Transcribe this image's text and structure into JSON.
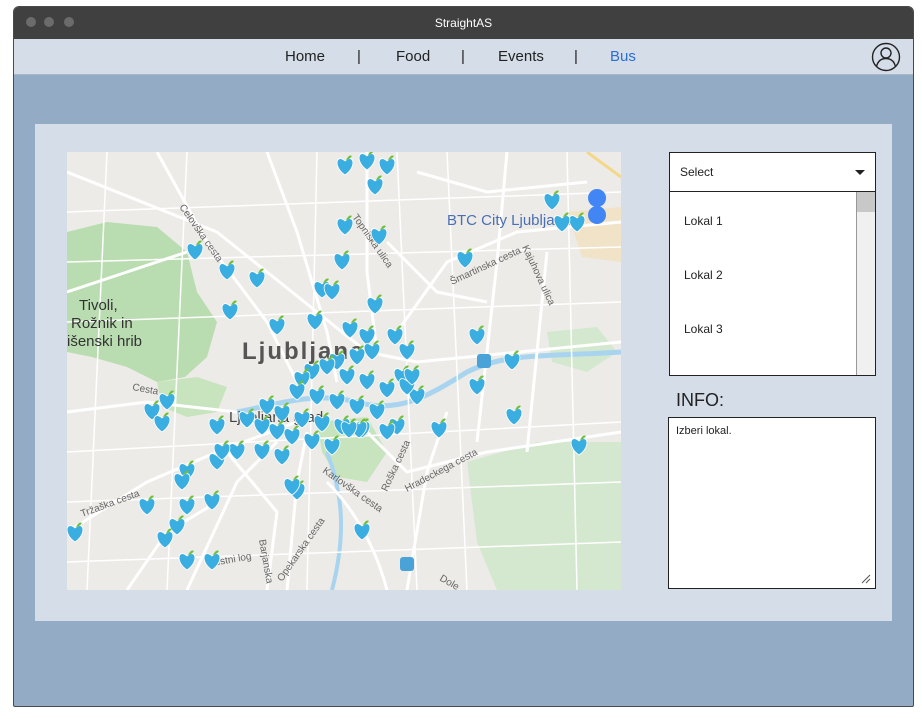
{
  "window": {
    "title": "StraightAS"
  },
  "nav": {
    "items": [
      {
        "label": "Home"
      },
      {
        "label": "Food"
      },
      {
        "label": "Events"
      },
      {
        "label": "Bus"
      }
    ],
    "separator": "|"
  },
  "map": {
    "city_label": "Ljubljana",
    "places": [
      "BTC City Ljubljana",
      "Tivoli,",
      "Rožnik in",
      "išenski hrib",
      "Ljubljana grad"
    ],
    "streets": [
      "Topniška ulica",
      "Šmartinska cesta",
      "Kajuhova ulica",
      "Celovška cesta",
      "Tržaška cesta",
      "Roška cesta",
      "Hradeckega cesta",
      "Karlovška cesta",
      "Opekarska cesta",
      "Barjanska",
      "Mestni log",
      "Dole",
      "Cesta"
    ]
  },
  "dropdown": {
    "selected": "Select",
    "options": [
      "Lokal 1",
      "Lokal 2",
      "Lokal 3"
    ]
  },
  "info": {
    "label": "INFO:",
    "text": "Izberi lokal."
  },
  "colors": {
    "marker": "#3aaee0",
    "active_nav": "#2b6fd1"
  }
}
